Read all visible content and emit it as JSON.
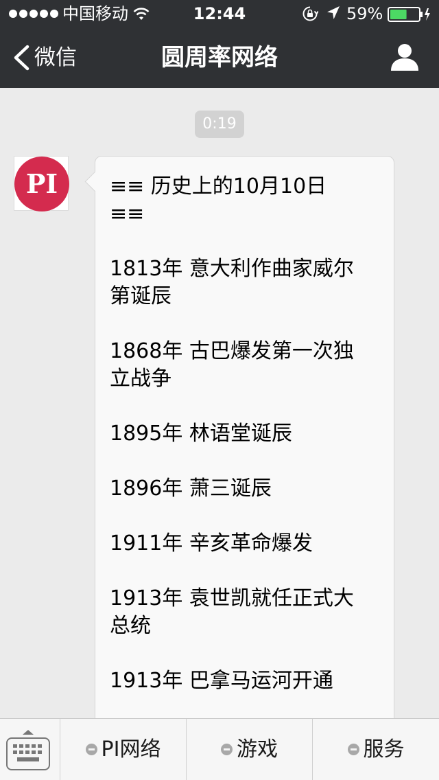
{
  "status_bar": {
    "carrier": "中国移动",
    "time": "12:44",
    "battery_percent": "59%",
    "battery_level": 0.59,
    "signal_dots": 5
  },
  "nav_bar": {
    "back_label": "微信",
    "title": "圆周率网络",
    "profile_icon": "person-icon"
  },
  "chat": {
    "time_badge": "0:19",
    "avatar_text": "PI",
    "message": {
      "heading_lines": [
        "≡≡ 历史上的10月10日",
        "≡≡"
      ],
      "entries": [
        {
          "lines": [
            "1813年 意大利作曲家威尔",
            "第诞辰"
          ]
        },
        {
          "lines": [
            "1868年 古巴爆发第一次独",
            "立战争"
          ]
        },
        {
          "lines": [
            "1895年 林语堂诞辰"
          ]
        },
        {
          "lines": [
            "1896年 萧三诞辰"
          ]
        },
        {
          "lines": [
            "1911年 辛亥革命爆发"
          ]
        },
        {
          "lines": [
            "1913年 袁世凯就任正式大",
            "总统"
          ]
        },
        {
          "lines": [
            "1913年 巴拿马运河开通"
          ]
        }
      ]
    }
  },
  "bottom_menu": {
    "keyboard_icon": "keyboard-icon",
    "items": [
      {
        "label": "PI网络"
      },
      {
        "label": "游戏"
      },
      {
        "label": "服务"
      }
    ]
  },
  "colors": {
    "header_bg": "#2f3134",
    "chat_bg": "#ebebeb",
    "avatar_red": "#d42b4e",
    "battery_green": "#4cd964"
  }
}
